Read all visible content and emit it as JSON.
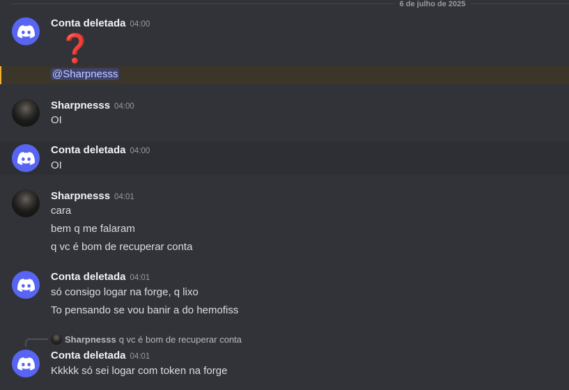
{
  "date_divider": "6 de julho de 2025",
  "messages": [
    {
      "user": "Conta deletada",
      "time": "04:00",
      "lines": [
        "@Sharpnesss"
      ],
      "emoji": "❓"
    },
    {
      "user": "Sharpnesss",
      "time": "04:00",
      "lines": [
        "OI"
      ]
    },
    {
      "user": "Conta deletada",
      "time": "04:00",
      "lines": [
        "OI"
      ]
    },
    {
      "user": "Sharpnesss",
      "time": "04:01",
      "lines": [
        "cara",
        "bem q me falaram",
        "q vc é bom de recuperar conta"
      ]
    },
    {
      "user": "Conta deletada",
      "time": "04:01",
      "lines": [
        "só consigo logar na forge, q lixo",
        "To pensando se vou banir a do hemofiss"
      ]
    },
    {
      "user": "Conta deletada",
      "time": "04:01",
      "lines": [
        "Kkkkk só sei logar com token na forge"
      ],
      "reply": {
        "user": "Sharpnesss",
        "text": "q vc é bom de recuperar conta"
      }
    }
  ],
  "colors": {
    "background": "#323339",
    "discord_blurple": "#5865f2",
    "mention_highlight": "#3b3629"
  },
  "icons": {
    "deleted_avatar": "discord-logo-icon",
    "user_avatar": "profile-photo"
  }
}
